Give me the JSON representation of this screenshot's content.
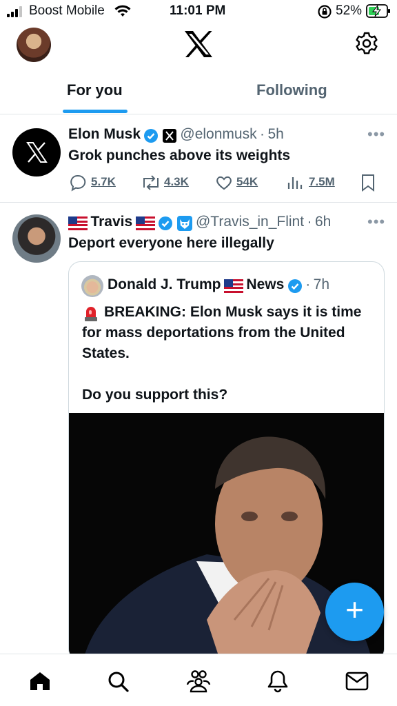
{
  "status_bar": {
    "carrier": "Boost Mobile",
    "time": "11:01 PM",
    "battery": "52%"
  },
  "tabs": [
    {
      "label": "For you"
    },
    {
      "label": "Following"
    }
  ],
  "tweets": [
    {
      "author": "Elon Musk",
      "handle": "@elonmusk",
      "time": "5h",
      "text": "Grok punches above its weights",
      "replies": "5.7K",
      "reposts": "4.3K",
      "likes": "54K",
      "views": "7.5M"
    },
    {
      "author": "Travis",
      "handle": "@Travis_in_Flint",
      "time": "6h",
      "text": "Deport everyone here illegally",
      "quote": {
        "author": "Donald J. Trump",
        "author_suffix": "News",
        "time": "7h",
        "text1": "BREAKING: Elon Musk says it is time for mass deportations from the United States.",
        "text2": "Do you support this?"
      }
    }
  ],
  "colors": {
    "accent": "#1d9bf0",
    "text": "#0f1419",
    "secondary": "#536471"
  },
  "icons": [
    "home-icon",
    "search-icon",
    "communities-icon",
    "bell-icon",
    "mail-icon",
    "gear-icon",
    "x-logo-icon",
    "compose-icon"
  ]
}
